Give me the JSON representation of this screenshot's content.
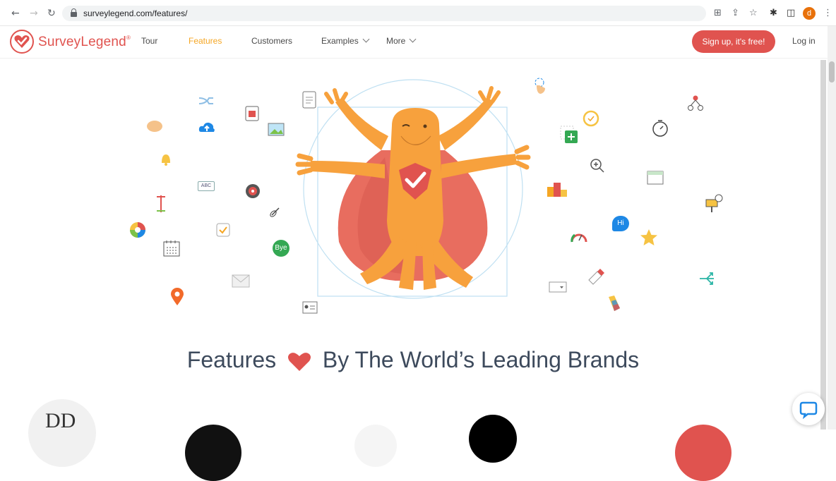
{
  "browser": {
    "url": "surveylegend.com/features/",
    "profile_initial": "d"
  },
  "site": {
    "logo_text": "SurveyLegend",
    "logo_mark": "®",
    "nav": {
      "tour": "Tour",
      "features": "Features",
      "customers": "Customers",
      "examples": "Examples",
      "more": "More"
    },
    "signup_label": "Sign up, it's free!",
    "login_label": "Log in"
  },
  "hero": {
    "icon_texts": {
      "abc": "ABC",
      "bye": "Bye",
      "hi": "Hi"
    }
  },
  "headline": {
    "before": "Features",
    "after": "By The World’s Leading Brands"
  },
  "brands": {
    "first_logo_text": "DD"
  },
  "colors": {
    "brand_red": "#e0534f",
    "active_nav": "#f5a623",
    "mascot_orange": "#f7a13d"
  }
}
